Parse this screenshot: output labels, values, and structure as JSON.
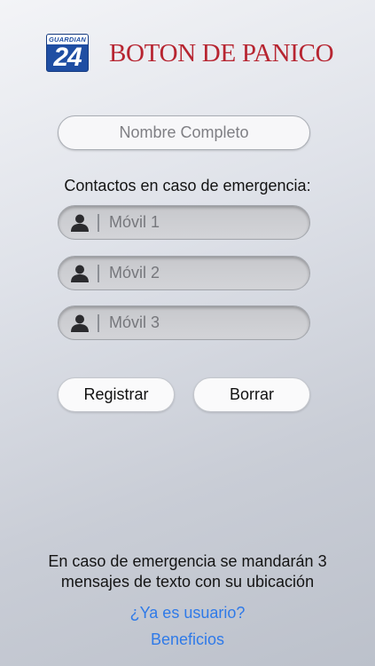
{
  "header": {
    "logo_top_text": "GUARDIAN",
    "logo_number": "24",
    "title": "BOTON DE PANICO"
  },
  "form": {
    "name_placeholder": "Nombre Completo",
    "contacts_label": "Contactos en caso de emergencia:",
    "phones": [
      {
        "placeholder": "Móvil 1",
        "icon": "person-icon"
      },
      {
        "placeholder": "Móvil 2",
        "icon": "person-icon"
      },
      {
        "placeholder": "Móvil 3",
        "icon": "person-icon"
      }
    ]
  },
  "actions": {
    "register_label": "Registrar",
    "clear_label": "Borrar"
  },
  "footer": {
    "note_line1": "En caso de emergencia se mandarán 3",
    "note_line2": "mensajes de texto con su ubicación",
    "already_user_link": "¿Ya es usuario?",
    "benefits_link": "Beneficios"
  },
  "colors": {
    "brand_red": "#b72531",
    "logo_blue": "#1f4ea3",
    "link_blue": "#2f7ae8"
  }
}
